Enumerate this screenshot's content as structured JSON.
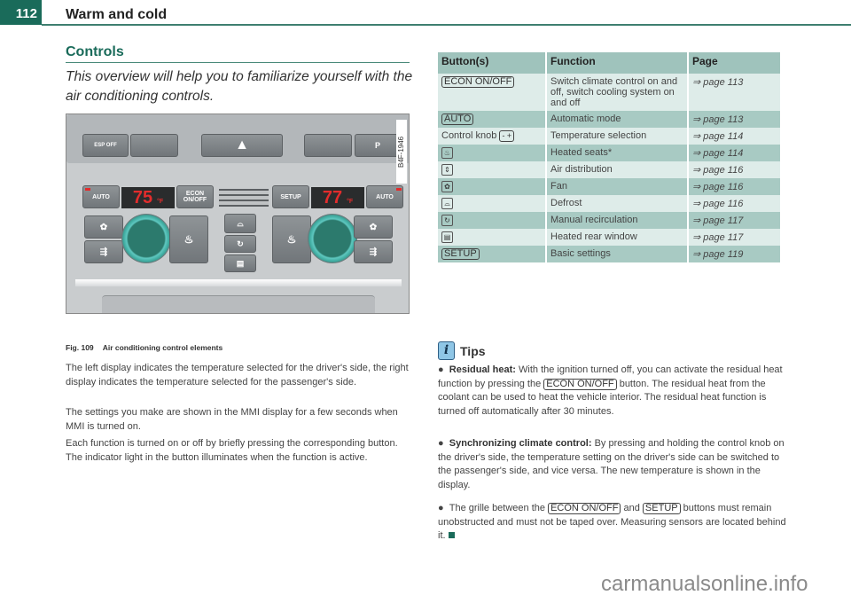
{
  "header": {
    "page_number": "112",
    "chapter_title": "Warm and cold",
    "accent_color": "#1a6b5a"
  },
  "section": {
    "title": "Controls",
    "intro": "This overview will help you to familiarize yourself with the air conditioning controls."
  },
  "figure": {
    "code": "B4F-1946",
    "caption_number": "Fig. 109",
    "caption_text": "Air conditioning control elements",
    "buttons": {
      "esp": "ESP OFF",
      "park": "P",
      "auto_left": "AUTO",
      "auto_right": "AUTO",
      "econ_line1": "ECON",
      "econ_line2": "ON/OFF",
      "setup": "SETUP"
    },
    "left_temp": "75",
    "right_temp": "77",
    "temp_unit": "°F",
    "knob_minus": "−",
    "knob_plus": "+"
  },
  "body_paragraphs": [
    "The left display indicates the temperature selected for the driver's side, the right display indicates the temperature selected for the passenger's side.",
    "The settings you make are shown in the MMI display for a few seconds when MMI is turned on.",
    "Each function is turned on or off by briefly pressing the corre­sponding button. The indicator light in the button illuminates when the function is active."
  ],
  "table": {
    "headers": [
      "Button(s)",
      "Function",
      "Page"
    ],
    "rows": [
      {
        "button": "ECON ON/OFF",
        "button_type": "key",
        "function": "Switch climate control on and off, switch cooling system on and off",
        "page": "⇒ page 113"
      },
      {
        "button": "AUTO",
        "button_type": "key",
        "function": "Automatic mode",
        "page": "⇒ page 113"
      },
      {
        "button": "Control knob",
        "button_suffix": "- +",
        "button_type": "text",
        "function": "Temperature selection",
        "page": "⇒ page 114"
      },
      {
        "button": "seat-icon",
        "button_glyph": "♨",
        "button_type": "icon",
        "function": "Heated seats*",
        "page": "⇒ page 114"
      },
      {
        "button": "air-distribution-icon",
        "button_glyph": "⇕",
        "button_type": "icon",
        "function": "Air distribution",
        "page": "⇒ page 116"
      },
      {
        "button": "fan-icon",
        "button_glyph": "✿",
        "button_type": "icon",
        "function": "Fan",
        "page": "⇒ page 116"
      },
      {
        "button": "defrost-icon",
        "button_glyph": "⌓",
        "button_type": "icon",
        "function": "Defrost",
        "page": "⇒ page 116"
      },
      {
        "button": "recirculation-icon",
        "button_glyph": "↻",
        "button_type": "icon",
        "function": "Manual recirculation",
        "page": "⇒ page 117"
      },
      {
        "button": "rear-window-heat-icon",
        "button_glyph": "▤",
        "button_type": "icon",
        "function": "Heated rear window",
        "page": "⇒ page 117"
      },
      {
        "button": "SETUP",
        "button_type": "key",
        "function": "Basic settings",
        "page": "⇒ page 119"
      }
    ]
  },
  "tips": {
    "title": "Tips",
    "items": [
      {
        "bold": "Residual heat:",
        "parts": [
          "With the ignition turned off, you can activate the residual heat function by pressing the ",
          "ECON ON/OFF",
          " button. The residual heat from the coolant can be used to heat the vehicle inte­rior. The residual heat function is turned off automatically after 30 minutes."
        ]
      },
      {
        "bold": "Synchronizing climate control:",
        "parts": [
          "By pressing and holding the control knob on the driver's side, the temperature setting on the driver's side can be switched to the passenger's side, and vice versa. The new temperature is shown in the display."
        ]
      },
      {
        "bold": "",
        "parts": [
          "The grille between the ",
          "ECON ON/OFF",
          " and ",
          "SETUP",
          " buttons must remain unobstructed and must not be taped over. Measuring sensors are located behind it."
        ]
      }
    ]
  },
  "watermark": "carmanualsonline.info"
}
